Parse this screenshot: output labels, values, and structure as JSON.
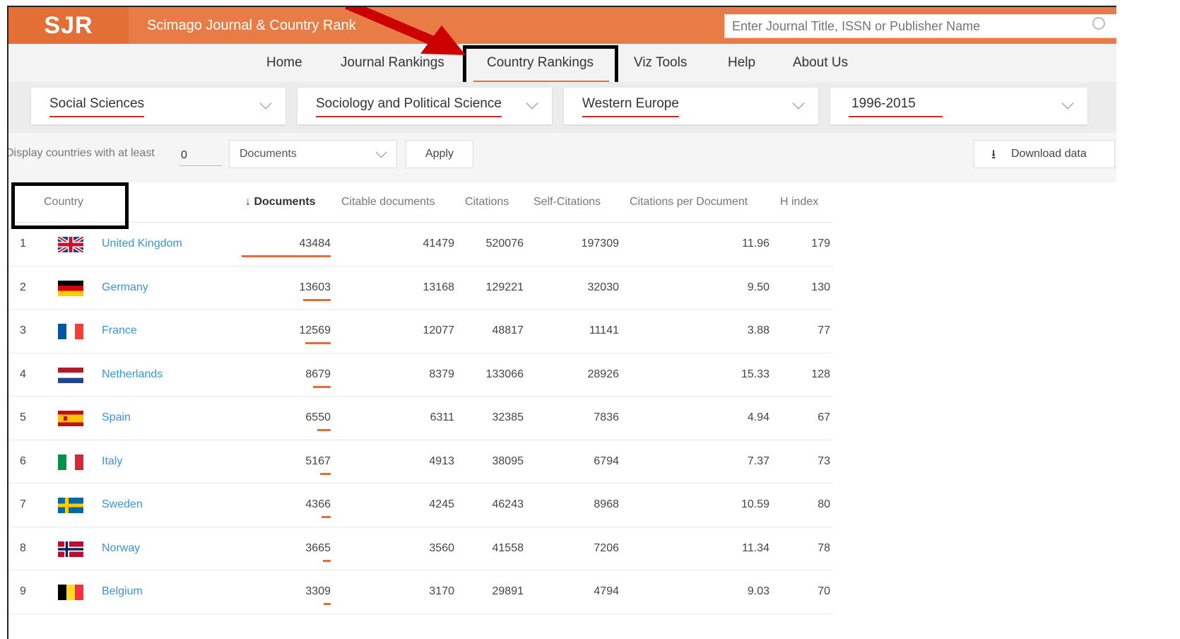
{
  "header": {
    "logo": "SJR",
    "site_name": "Scimago Journal & Country Rank",
    "search_placeholder": "Enter Journal Title, ISSN or Publisher Name"
  },
  "nav": [
    "Home",
    "Journal Rankings",
    "Country Rankings",
    "Viz Tools",
    "Help",
    "About Us"
  ],
  "filters": {
    "subject_area": "Social Sciences",
    "subject_category": "Sociology and Political Science",
    "region": "Western Europe",
    "period": "1996-2015"
  },
  "controls": {
    "min_label": "Display countries with at least",
    "min_value": "0",
    "metric": "Documents",
    "apply": "Apply",
    "download": "Download data"
  },
  "table": {
    "headers": [
      "Country",
      "Documents",
      "Citable documents",
      "Citations",
      "Self-Citations",
      "Citations per Document",
      "H index"
    ],
    "sort_arrow": "↓",
    "rows": [
      {
        "rank": "1",
        "country": "United Kingdom",
        "flag": "uk",
        "documents": "43484",
        "citable": "41479",
        "citations": "520076",
        "self_citations": "197309",
        "cpd": "11.96",
        "h": "179",
        "doc_share": 1.0
      },
      {
        "rank": "2",
        "country": "Germany",
        "flag": "de",
        "documents": "13603",
        "citable": "13168",
        "citations": "129221",
        "self_citations": "32030",
        "cpd": "9.50",
        "h": "130",
        "doc_share": 0.313
      },
      {
        "rank": "3",
        "country": "France",
        "flag": "fr",
        "documents": "12569",
        "citable": "12077",
        "citations": "48817",
        "self_citations": "11141",
        "cpd": "3.88",
        "h": "77",
        "doc_share": 0.289
      },
      {
        "rank": "4",
        "country": "Netherlands",
        "flag": "nl",
        "documents": "8679",
        "citable": "8379",
        "citations": "133066",
        "self_citations": "28926",
        "cpd": "15.33",
        "h": "128",
        "doc_share": 0.2
      },
      {
        "rank": "5",
        "country": "Spain",
        "flag": "es",
        "documents": "6550",
        "citable": "6311",
        "citations": "32385",
        "self_citations": "7836",
        "cpd": "4.94",
        "h": "67",
        "doc_share": 0.151
      },
      {
        "rank": "6",
        "country": "Italy",
        "flag": "it",
        "documents": "5167",
        "citable": "4913",
        "citations": "38095",
        "self_citations": "6794",
        "cpd": "7.37",
        "h": "73",
        "doc_share": 0.119
      },
      {
        "rank": "7",
        "country": "Sweden",
        "flag": "se",
        "documents": "4366",
        "citable": "4245",
        "citations": "46243",
        "self_citations": "8968",
        "cpd": "10.59",
        "h": "80",
        "doc_share": 0.1
      },
      {
        "rank": "8",
        "country": "Norway",
        "flag": "no",
        "documents": "3665",
        "citable": "3560",
        "citations": "41558",
        "self_citations": "7206",
        "cpd": "11.34",
        "h": "78",
        "doc_share": 0.084
      },
      {
        "rank": "9",
        "country": "Belgium",
        "flag": "be",
        "documents": "3309",
        "citable": "3170",
        "citations": "29891",
        "self_citations": "4794",
        "cpd": "9.03",
        "h": "70",
        "doc_share": 0.076
      }
    ]
  },
  "colors": {
    "header_orange": "#e87c47",
    "logo_orange": "#e36e36",
    "link_blue": "#3a96d2",
    "underline_red": "#c82a2a",
    "arrow_red": "#cc0000"
  }
}
